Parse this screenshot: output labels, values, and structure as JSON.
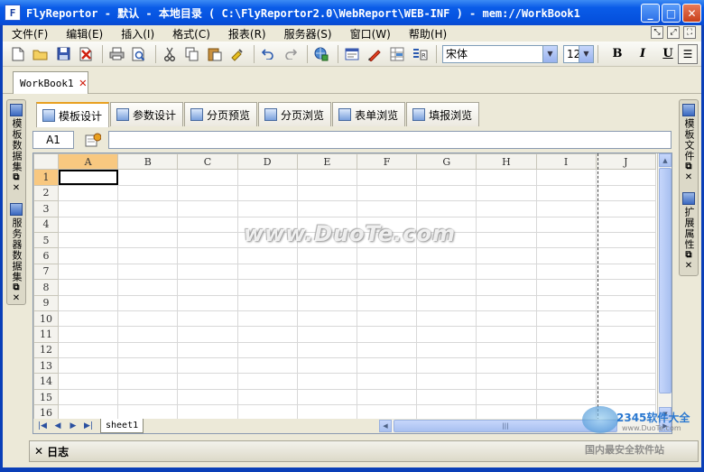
{
  "window": {
    "logo": "F",
    "title": "FlyReportor   - 默认 - 本地目录 ( C:\\FlyReportor2.0\\WebReport\\WEB-INF )  - mem://WorkBook1",
    "minimize": "_",
    "maximize": "□",
    "close": "✕"
  },
  "menu": {
    "items": [
      "文件(F)",
      "编辑(E)",
      "插入(I)",
      "格式(C)",
      "报表(R)",
      "服务器(S)",
      "窗口(W)",
      "帮助(H)"
    ]
  },
  "toolbar": {
    "font_name": "宋体",
    "font_size": "12",
    "bold": "B",
    "italic": "I",
    "underline": "U"
  },
  "document": {
    "tab_label": "WorkBook1",
    "close_glyph": "✕"
  },
  "left_panel": {
    "items": [
      {
        "label": "模板数据集"
      },
      {
        "label": "服务器数据集"
      }
    ]
  },
  "right_panel": {
    "items": [
      {
        "label": "模板文件"
      },
      {
        "label": "扩展属性"
      }
    ]
  },
  "design_tabs": [
    {
      "label": "模板设计",
      "active": true
    },
    {
      "label": "参数设计",
      "active": false
    },
    {
      "label": "分页预览",
      "active": false
    },
    {
      "label": "分页浏览",
      "active": false
    },
    {
      "label": "表单浏览",
      "active": false
    },
    {
      "label": "填报浏览",
      "active": false
    }
  ],
  "formula_bar": {
    "cell_ref": "A1",
    "value": ""
  },
  "grid": {
    "columns": [
      "A",
      "B",
      "C",
      "D",
      "E",
      "F",
      "G",
      "H",
      "I",
      "J"
    ],
    "rows": [
      "1",
      "2",
      "3",
      "4",
      "5",
      "6",
      "7",
      "8",
      "9",
      "10",
      "11",
      "12",
      "13",
      "14",
      "15",
      "16"
    ],
    "selected_column": "A",
    "selected_row": "1"
  },
  "sheets": {
    "tabs": [
      "sheet1"
    ]
  },
  "log": {
    "label": "日志"
  },
  "watermarks": {
    "center": "www.DuoTe.com",
    "brand": "2345软件大全",
    "brand_url": "www.DuoTe.com",
    "footer": "国内最安全软件站"
  }
}
